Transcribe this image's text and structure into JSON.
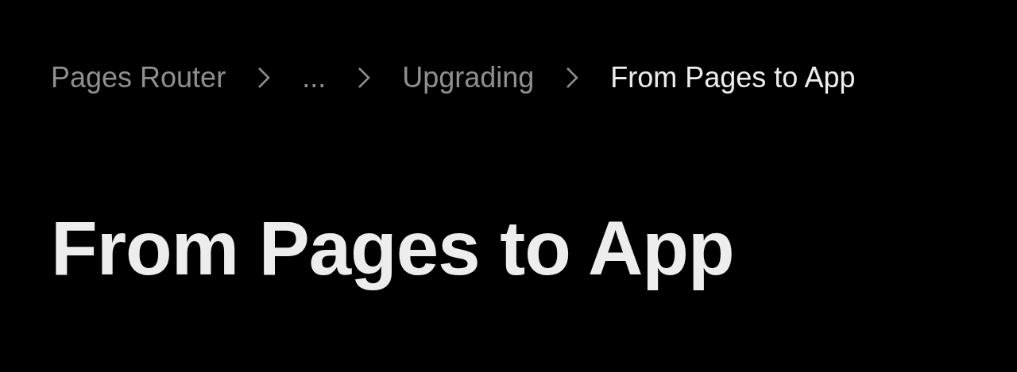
{
  "breadcrumb": [
    {
      "label": "Pages Router",
      "selected": false
    },
    {
      "label": "...",
      "selected": false
    },
    {
      "label": "Upgrading",
      "selected": false
    },
    {
      "label": "From Pages to App",
      "selected": true
    }
  ],
  "title": "From Pages to App"
}
